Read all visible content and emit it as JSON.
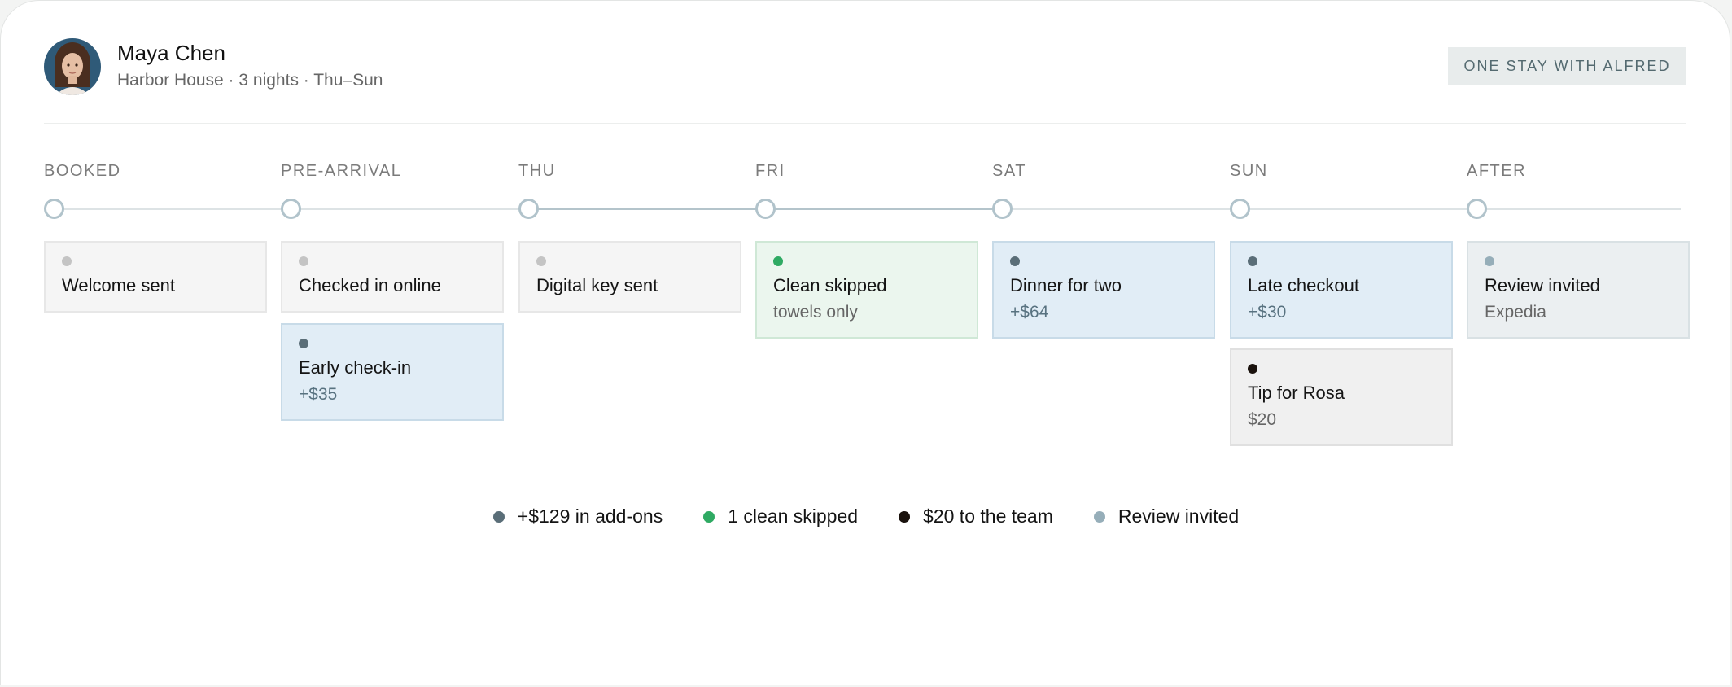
{
  "header": {
    "guest_name": "Maya Chen",
    "stay_details": "Harbor House · 3 nights · Thu–Sun",
    "tag": "ONE STAY WITH ALFRED"
  },
  "timeline": {
    "stages": [
      {
        "label": "BOOKED",
        "events": [
          {
            "title": "Welcome sent",
            "sub": "",
            "kind": "neutral",
            "dot": "#c4c4c4"
          }
        ]
      },
      {
        "label": "PRE-ARRIVAL",
        "events": [
          {
            "title": "Checked in online",
            "sub": "",
            "kind": "neutral",
            "dot": "#c4c4c4"
          },
          {
            "title": "Early check-in",
            "sub": "+$35",
            "kind": "addon",
            "dot": "#5a6e78"
          }
        ]
      },
      {
        "label": "THU",
        "events": [
          {
            "title": "Digital key sent",
            "sub": "",
            "kind": "neutral",
            "dot": "#c4c4c4"
          }
        ]
      },
      {
        "label": "FRI",
        "events": [
          {
            "title": "Clean skipped",
            "sub": "towels only",
            "kind": "clean",
            "dot": "#2faa63"
          }
        ]
      },
      {
        "label": "SAT",
        "events": [
          {
            "title": "Dinner for two",
            "sub": "+$64",
            "kind": "addon",
            "dot": "#5a6e78"
          }
        ]
      },
      {
        "label": "SUN",
        "events": [
          {
            "title": "Late checkout",
            "sub": "+$30",
            "kind": "addon",
            "dot": "#5a6e78"
          },
          {
            "title": "Tip for Rosa",
            "sub": "$20",
            "kind": "tip",
            "dot": "#1a120d"
          }
        ]
      },
      {
        "label": "AFTER",
        "events": [
          {
            "title": "Review invited",
            "sub": "Expedia",
            "kind": "review",
            "dot": "#96aeb9"
          }
        ]
      }
    ]
  },
  "legend": [
    {
      "text": "+$129 in add-ons",
      "color": "#5a6e78"
    },
    {
      "text": "1 clean skipped",
      "color": "#2faa63"
    },
    {
      "text": "$20 to the team",
      "color": "#1a120d"
    },
    {
      "text": "Review invited",
      "color": "#96aeb9"
    }
  ],
  "colors": {
    "track": "#dde3e5",
    "node_ring": "#b1c3cb",
    "addon_bg": "#e1edf6",
    "clean_bg": "#ebf6ee"
  }
}
